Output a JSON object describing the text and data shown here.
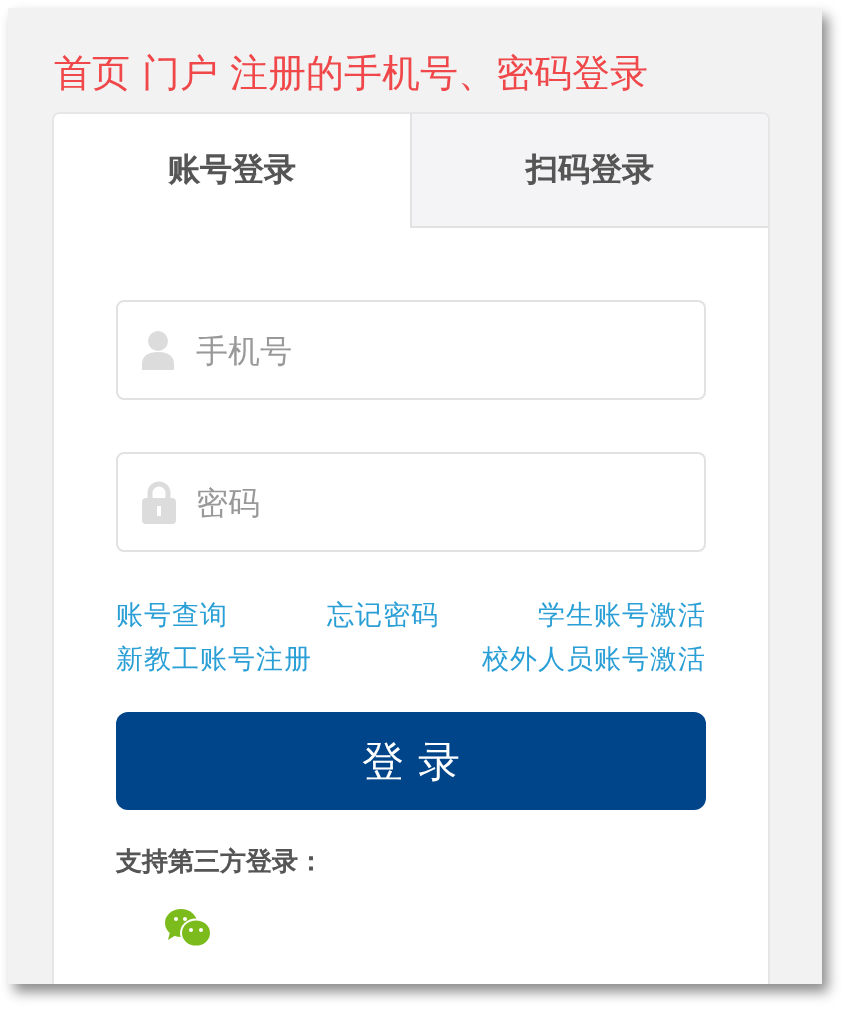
{
  "heading": "首页 门户 注册的手机号、密码登录",
  "tabs": [
    {
      "label": "账号登录",
      "selected": true
    },
    {
      "label": "扫码登录",
      "selected": false
    }
  ],
  "fields": [
    {
      "kind": "phone",
      "placeholder": "手机号"
    },
    {
      "kind": "password",
      "placeholder": "密码"
    }
  ],
  "link_rows": [
    {
      "links": [
        "账号查询",
        "忘记密码",
        "学生账号激活"
      ]
    },
    {
      "links": [
        "新教工账号注册",
        "校外人员账号激活"
      ]
    }
  ],
  "login_button": "登 录",
  "third_party": {
    "label": "支持第三方登录：",
    "providers": [
      {
        "kind": "wechat"
      }
    ]
  }
}
